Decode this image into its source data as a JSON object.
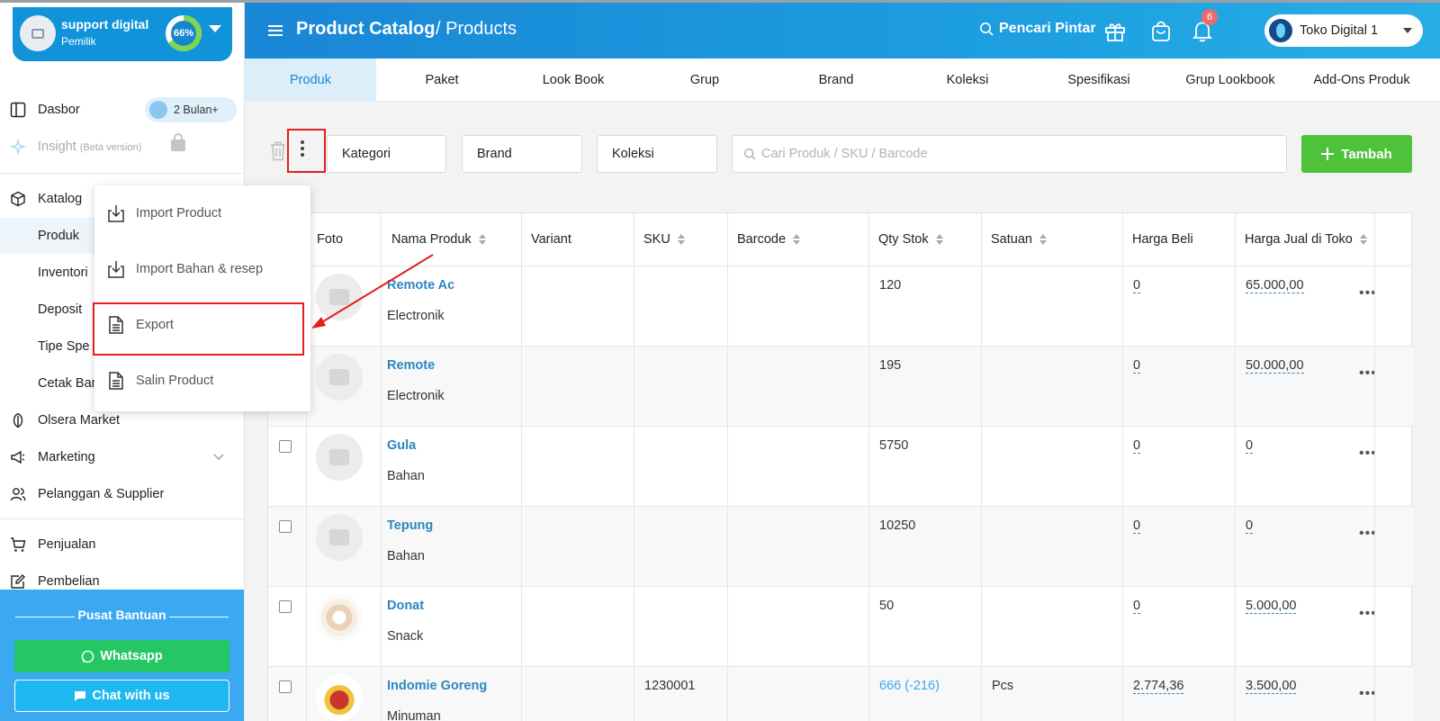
{
  "profile": {
    "name": "support digital",
    "role": "Pemilik",
    "progress_label": "66%",
    "progress": 0.66
  },
  "sidebar": {
    "dasbor": "Dasbor",
    "plan_badge": "2 Bulan+",
    "insight": "Insight",
    "insight_sub": "(Beta version)",
    "katalog": "Katalog",
    "items": [
      "Produk",
      "Inventori",
      "Deposit",
      "Tipe Spe",
      "Cetak Bar"
    ],
    "olsera_market": "Olsera Market",
    "marketing": "Marketing",
    "pelanggan": "Pelanggan & Supplier",
    "penjualan": "Penjualan",
    "pembelian": "Pembelian"
  },
  "help": {
    "title": "Pusat Bantuan",
    "whatsapp": "Whatsapp",
    "chat": "Chat with us"
  },
  "topbar": {
    "title_main": "Product Catalog",
    "title_sub": "/ Products",
    "smart_search": "Pencari Pintar",
    "notif_count": "6",
    "store": "Toko Digital 1"
  },
  "tabs": [
    "Produk",
    "Paket",
    "Look Book",
    "Grup",
    "Brand",
    "Koleksi",
    "Spesifikasi",
    "Grup Lookbook",
    "Add-Ons Produk"
  ],
  "filters": {
    "kategori": "Kategori",
    "brand": "Brand",
    "koleksi": "Koleksi",
    "search_placeholder": "Cari Produk / SKU / Barcode",
    "add": "Tambah"
  },
  "menu": [
    "Import Product",
    "Import Bahan & resep",
    "Export",
    "Salin Product"
  ],
  "table": {
    "headers": [
      "Foto",
      "Nama Produk",
      "Variant",
      "SKU",
      "Barcode",
      "Qty Stok",
      "Satuan",
      "Harga Beli",
      "Harga Jual di Toko"
    ],
    "rows": [
      {
        "name": "Remote Ac",
        "category": "Electronik",
        "sku": "",
        "qty": "120",
        "unit": "",
        "buy": "0",
        "sell": "65.000,00"
      },
      {
        "name": "Remote",
        "category": "Electronik",
        "sku": "",
        "qty": "195",
        "unit": "",
        "buy": "0",
        "sell": "50.000,00"
      },
      {
        "name": "Gula",
        "category": "Bahan",
        "sku": "",
        "qty": "5750",
        "unit": "",
        "buy": "0",
        "sell": "0"
      },
      {
        "name": "Tepung",
        "category": "Bahan",
        "sku": "",
        "qty": "10250",
        "unit": "",
        "buy": "0",
        "sell": "0"
      },
      {
        "name": "Donat",
        "category": "Snack",
        "sku": "",
        "qty": "50",
        "unit": "",
        "buy": "0",
        "sell": "5.000,00"
      },
      {
        "name": "Indomie Goreng",
        "category": "Minuman",
        "sku": "1230001",
        "qty": "666 (-216)",
        "unit": "Pcs",
        "buy": "2.774,36",
        "sell": "3.500,00"
      }
    ]
  },
  "colors": {
    "brand_blue": "#1a86d6",
    "add_green": "#4ec23a",
    "highlight_red": "#e02020"
  }
}
